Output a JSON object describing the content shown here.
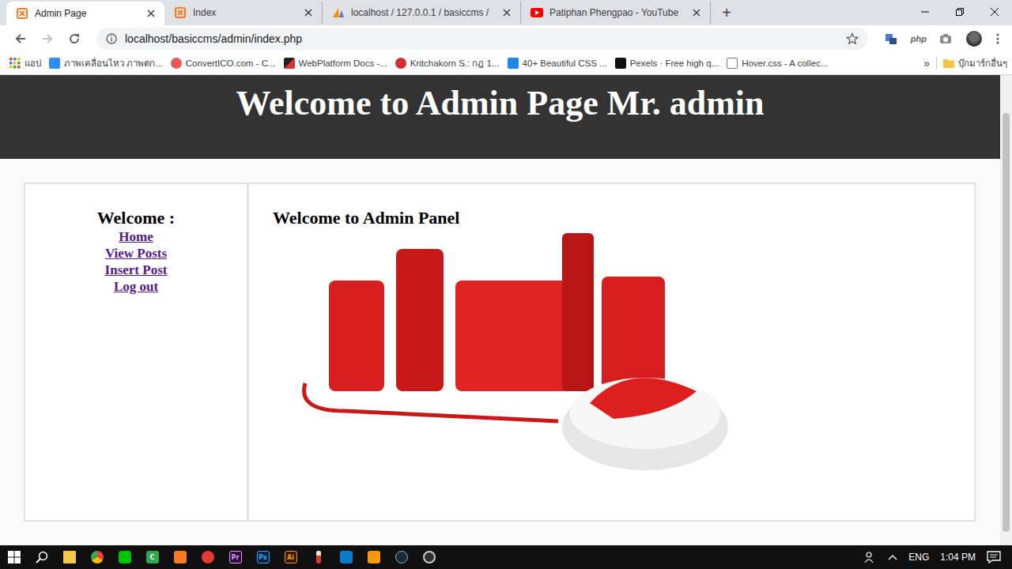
{
  "window": {
    "title": "Admin Page"
  },
  "tabs": [
    {
      "label": "Admin Page",
      "selected": true,
      "kind": "xampp"
    },
    {
      "label": "Index",
      "selected": false,
      "kind": "xampp"
    },
    {
      "label": "localhost / 127.0.0.1 / basiccms /",
      "selected": false,
      "kind": "pma"
    },
    {
      "label": "Patiphan Phengpao - YouTube",
      "selected": false,
      "kind": "youtube"
    }
  ],
  "new_tab": "+",
  "address_bar": {
    "url": "localhost/basiccms/admin/index.php"
  },
  "extensions": [
    {
      "label": "php"
    }
  ],
  "bookmarks": {
    "items": [
      {
        "label": "แอป",
        "kind": "apps"
      },
      {
        "label": "ภาพเคลื่อนไหว ภาพตก...",
        "kind": "zoom"
      },
      {
        "label": "ConvertICO.com - C...",
        "kind": "convertico"
      },
      {
        "label": "WebPlatform Docs -...",
        "kind": "webplatform"
      },
      {
        "label": "Kritchakorn S.: กฎ 1...",
        "kind": "kritchakorn"
      },
      {
        "label": "40+ Beautiful CSS ...",
        "kind": "css"
      },
      {
        "label": "Pexels · Free high q...",
        "kind": "pexels"
      },
      {
        "label": "Hover.css - A collec...",
        "kind": "page"
      }
    ],
    "more": "»",
    "other": "บุ๊กมาร์กอื่นๆ"
  },
  "page": {
    "header": "Welcome to Admin Page Mr. admin",
    "sidebar": {
      "title": "Welcome :",
      "links": [
        "Home",
        "View Posts",
        "Insert Post",
        "Log out"
      ]
    },
    "content": {
      "title": "Welcome to Admin Panel"
    }
  },
  "taskbar": {
    "apps": [
      {
        "kind": "explorer",
        "label": ""
      },
      {
        "kind": "chrome",
        "label": ""
      },
      {
        "kind": "line",
        "label": ""
      },
      {
        "kind": "camtasia",
        "label": "C"
      },
      {
        "kind": "xampp",
        "label": ""
      },
      {
        "kind": "recorder",
        "label": ""
      },
      {
        "kind": "premiere",
        "label": "Pr"
      },
      {
        "kind": "photoshop",
        "label": "Ps"
      },
      {
        "kind": "illustrator",
        "label": "Ai"
      },
      {
        "kind": "pen",
        "label": ""
      },
      {
        "kind": "vscode",
        "label": ""
      },
      {
        "kind": "sublime",
        "label": ""
      },
      {
        "kind": "steam",
        "label": ""
      },
      {
        "kind": "obs",
        "label": ""
      }
    ],
    "language": "ENG",
    "time": "1:04 PM"
  }
}
